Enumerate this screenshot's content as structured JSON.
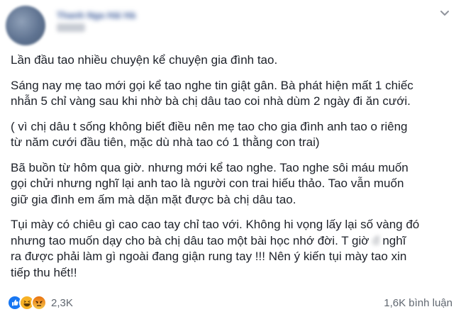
{
  "post": {
    "author_name": "Thanh Nga Hải Hà",
    "paragraphs": {
      "p1": "Lần đầu tao nhiều chuyện kể chuyện gia đình tao.",
      "p2": "Sáng nay mẹ tao mới gọi kể tao nghe tin giật gân. Bà phát hiện mất 1 chiếc\nnhẫn 5 chỉ vàng sau khi nhờ bà chị dâu tao coi nhà dùm 2 ngày đi ăn cưới.",
      "p3": "( vì chị dâu t sống không biết điều nên mẹ tao cho gia đình anh tao o riêng\ntừ năm cưới đầu tiên, mặc dù nhà tao có 1 thằng con trai)",
      "p4": "Bã buồn từ hôm qua giờ. nhưng mới kể tao nghe. Tao nghe sôi máu muốn\ngọi chửi nhưng nghĩ lại anh tao là người con trai hiếu thảo. Tao vẫn muốn\ngiữ gia đình em ấm mà dặn mặt được bà chị dâu tao.",
      "p5_part1": "Tụi mày có chiêu gì cao cao tay chỉ tao với. Không hi vọng lấy lại số vàng đó\nnhưng tao muốn dạy cho bà chị dâu tao một bài học nhớ đời. T giờ ",
      "p5_blurred": "đ",
      "p5_part2": " nghĩ\nra được phải làm gì ngoài đang giận rung tay !!! Nên ý kiến tụi mày tao xin\ntiếp thu hết!!"
    },
    "reactions": {
      "types": [
        "like",
        "haha",
        "angry"
      ],
      "count": "2,3K"
    },
    "comments": {
      "count_text": "1,6K bình luận"
    }
  },
  "icons": {
    "avatar": "avatar",
    "menu": "chevron-down-icon",
    "like": "like-reaction-icon",
    "haha": "haha-reaction-icon",
    "angry": "angry-reaction-icon"
  },
  "colors": {
    "text": "#1d2129",
    "secondary": "#606770",
    "link_blue": "#385898",
    "like_blue": "#1877f2",
    "haha_yellow": "#f7b125",
    "angry_orange": "#e9710f"
  }
}
